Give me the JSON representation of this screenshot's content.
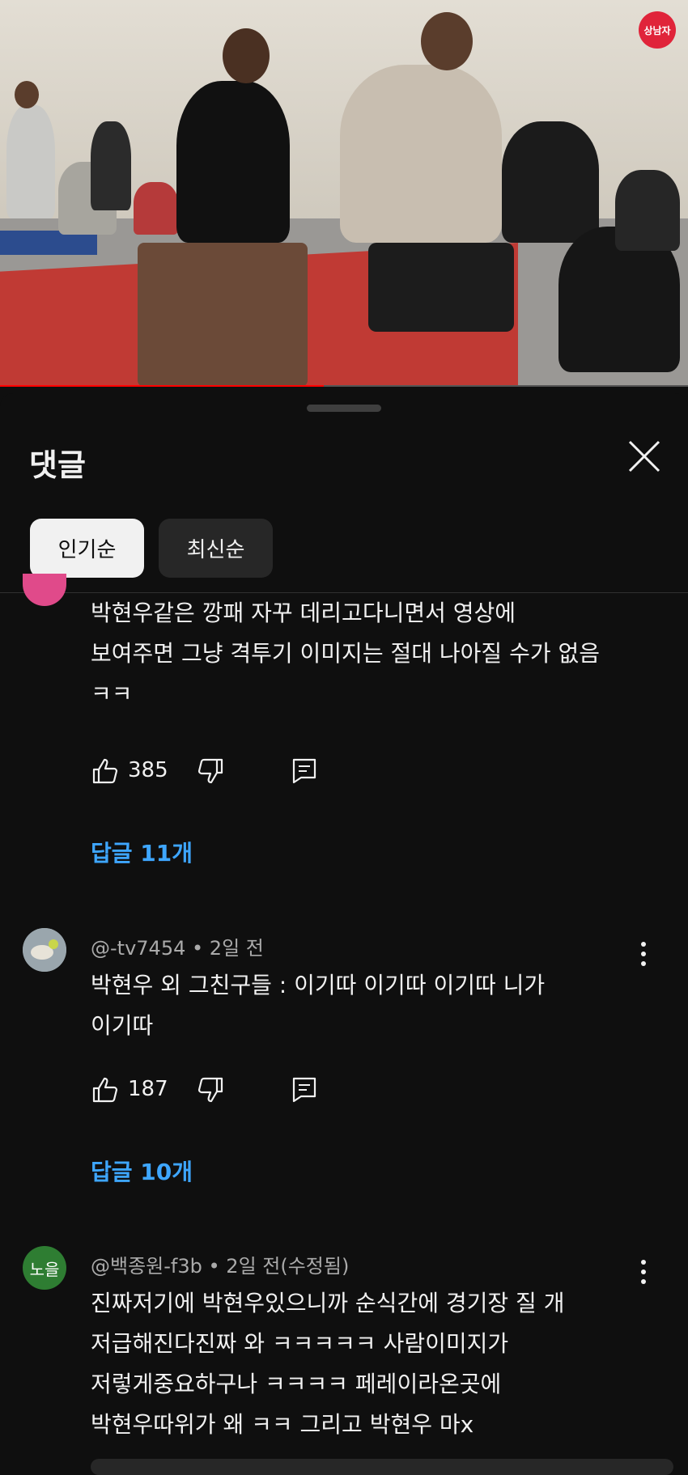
{
  "video": {
    "channel_badge": "상남자",
    "progress_fraction": 0.47,
    "accent": "#ff0000"
  },
  "comments_panel": {
    "title": "댓글",
    "close_icon": "close-icon",
    "sort_chips": [
      {
        "label": "인기순",
        "selected": true
      },
      {
        "label": "최신순",
        "selected": false
      }
    ]
  },
  "comments": [
    {
      "text_lines": [
        "박현우같은 깡패 자꾸 데리고다니면서 영상에",
        "보여주면 그냥 격투기 이미지는 절대 나아질 수가 없음",
        "ㅋㅋ"
      ],
      "likes": "385",
      "replies": "답글 11개"
    },
    {
      "author": "@-tv7454",
      "time": "2일 전",
      "text_lines": [
        "박현우 외 그친구들 : 이기따 이기따 이기따 니가",
        "이기따"
      ],
      "likes": "187",
      "replies": "답글 10개"
    },
    {
      "author": "@백종원-f3b",
      "time": "2일 전(수정됨)",
      "avatar_text": "노을",
      "text_lines": [
        "진짜저기에 박현우있으니까 순식간에 경기장 질 개",
        "저급해진다진짜 와 ㅋㅋㅋㅋㅋ 사람이미지가",
        "저렇게중요하구나 ㅋㅋㅋㅋ 페레이라온곳에",
        "박현우따위가 왜 ㅋㅋ 그리고 박현우 마x"
      ]
    }
  ],
  "colors": {
    "background": "#0f0f0f",
    "reply_link": "#3ea6ff",
    "meta_text": "#aaaaaa",
    "chip_selected": "#f1f1f1",
    "chip_unselected": "#272727"
  }
}
